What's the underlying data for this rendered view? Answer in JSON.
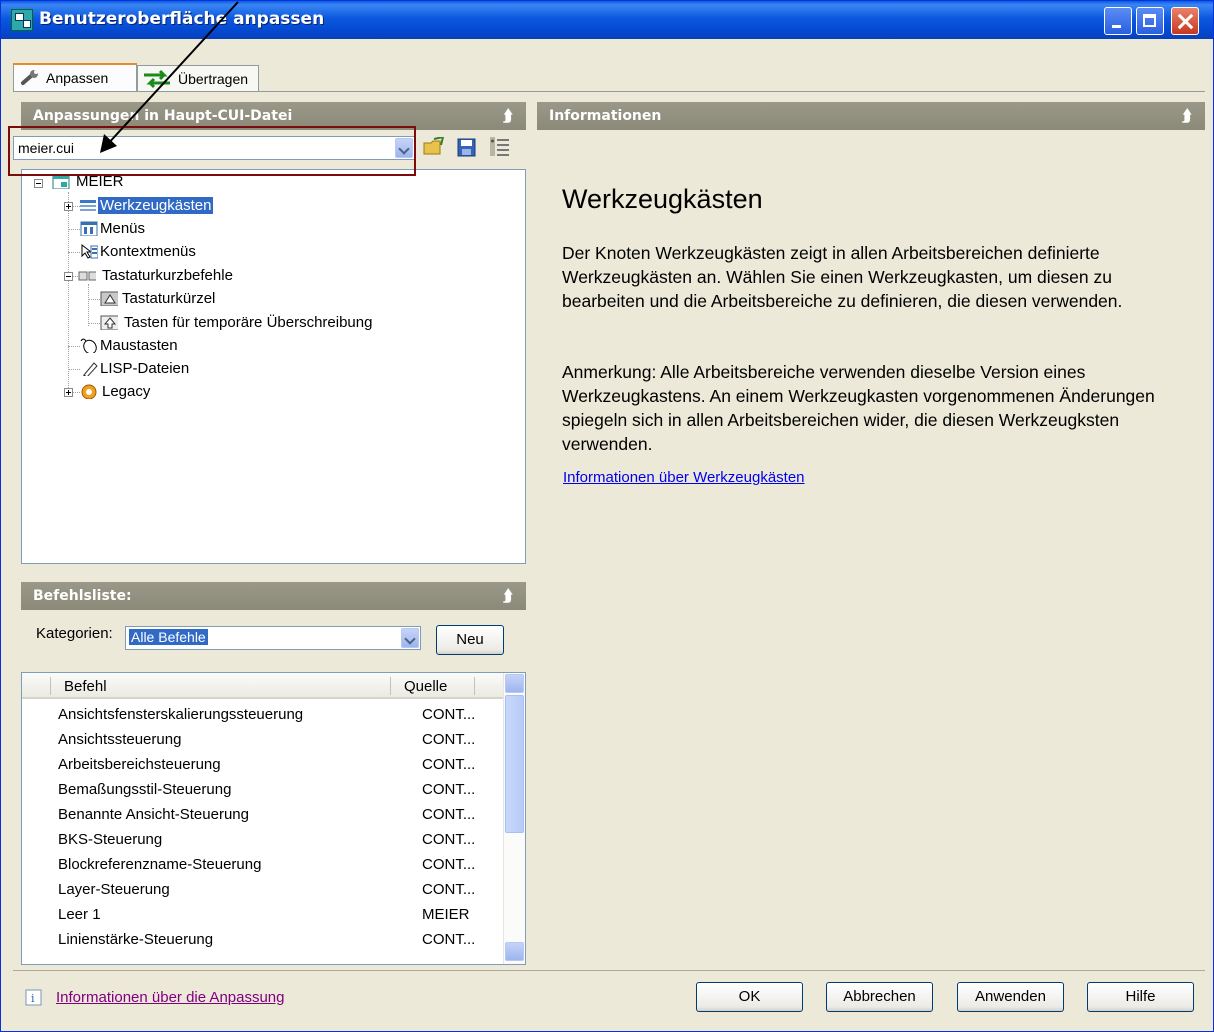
{
  "window": {
    "title": "Benutzeroberfläche anpassen"
  },
  "tabs": [
    {
      "label": "Anpassen",
      "active": true
    },
    {
      "label": "Übertragen",
      "active": false
    }
  ],
  "left_panel": {
    "header": "Anpassungen in Haupt-CUI-Datei",
    "file_combo": {
      "value": "meier.cui"
    },
    "tree": {
      "root": "MEIER",
      "items": [
        {
          "label": "Werkzeugkästen",
          "selected": true
        },
        {
          "label": "Menüs"
        },
        {
          "label": "Kontextmenüs"
        },
        {
          "label": "Tastaturkurzbefehle"
        },
        {
          "label": "Tastaturkürzel"
        },
        {
          "label": "Tasten für temporäre Überschreibung"
        },
        {
          "label": "Maustasten"
        },
        {
          "label": "LISP-Dateien"
        },
        {
          "label": "Legacy"
        }
      ]
    }
  },
  "command_panel": {
    "header": "Befehlsliste:",
    "kategorien_label": "Kategorien:",
    "kategorien_value": "Alle Befehle",
    "new_button": "Neu",
    "columns": [
      "Befehl",
      "Quelle"
    ],
    "rows": [
      {
        "befehl": "Ansichtsfensterskalierungssteuerung",
        "quelle": "CONT..."
      },
      {
        "befehl": "Ansichtssteuerung",
        "quelle": "CONT..."
      },
      {
        "befehl": "Arbeitsbereichsteuerung",
        "quelle": "CONT..."
      },
      {
        "befehl": "Bemaßungsstil-Steuerung",
        "quelle": "CONT..."
      },
      {
        "befehl": "Benannte Ansicht-Steuerung",
        "quelle": "CONT..."
      },
      {
        "befehl": "BKS-Steuerung",
        "quelle": "CONT..."
      },
      {
        "befehl": "Blockreferenzname-Steuerung",
        "quelle": "CONT..."
      },
      {
        "befehl": "Layer-Steuerung",
        "quelle": "CONT..."
      },
      {
        "befehl": "Leer 1",
        "quelle": "MEIER"
      },
      {
        "befehl": "Linienstärke-Steuerung",
        "quelle": "CONT..."
      }
    ]
  },
  "info_panel": {
    "header": "Informationen",
    "heading": "Werkzeugkästen",
    "paragraph1": "Der Knoten Werkzeugkästen zeigt in allen Arbeitsbereichen definierte Werkzeugkästen an. Wählen Sie einen Werkzeugkasten, um diesen zu bearbeiten und die Arbeitsbereiche zu definieren, die diesen verwenden.",
    "paragraph2": "Anmerkung: Alle Arbeitsbereiche verwenden dieselbe Version eines Werkzeugkastens. An einem Werkzeugkasten vorgenommenen Änderungen spiegeln sich in allen Arbeitsbereichen wider, die diesen Werkzeugksten verwenden.",
    "link": "Informationen über Werkzeugkästen"
  },
  "footer": {
    "info_link": "Informationen über die Anpassung",
    "buttons": {
      "ok": "OK",
      "cancel": "Abbrechen",
      "apply": "Anwenden",
      "help": "Hilfe"
    }
  },
  "colors": {
    "title_bar": "#0a5ce9",
    "panel_header": "#9a9888",
    "dialog_bg": "#ece9d8",
    "selection": "#316ac5",
    "annotation": "#7c0b0b"
  }
}
